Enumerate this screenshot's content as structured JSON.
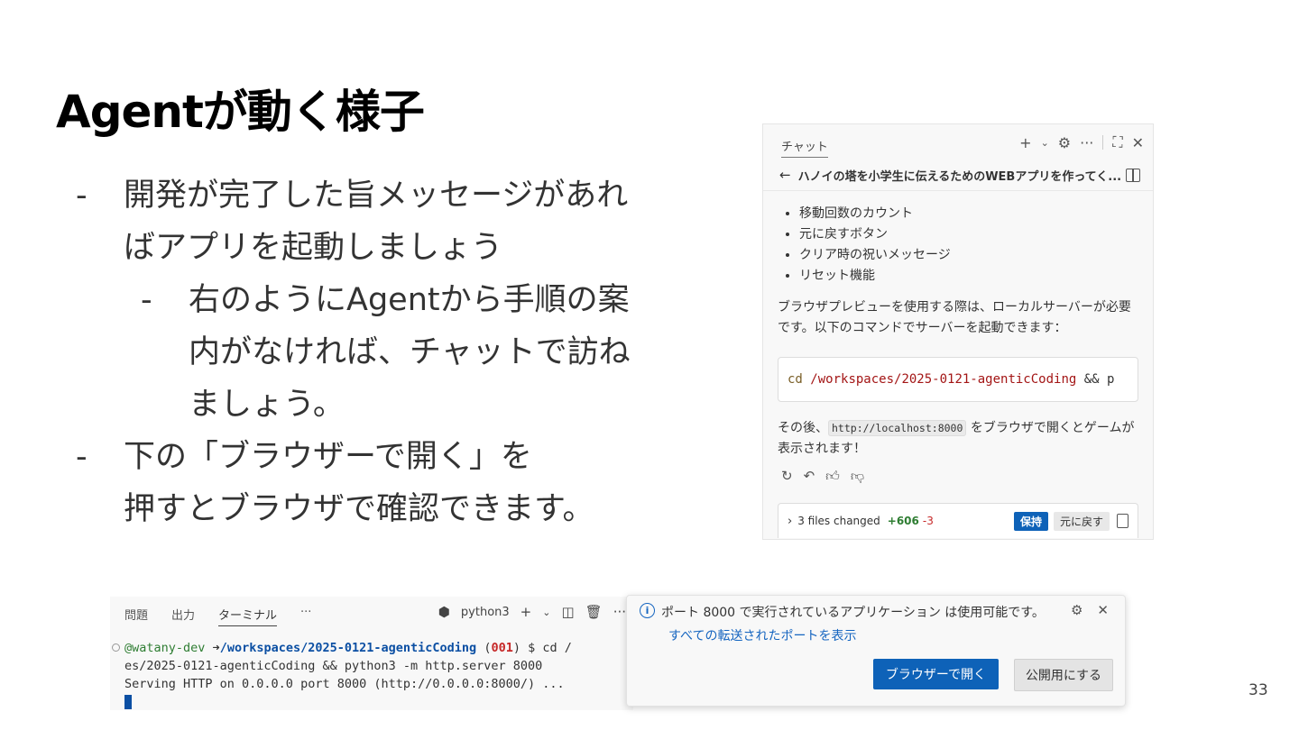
{
  "slide": {
    "title": "Agentが動く様子",
    "page_number": "33",
    "bullets": [
      {
        "lines": [
          "開発が完了した旨メッセージがあれ",
          "ばアプリを起動しましょう"
        ]
      },
      {
        "lines": [
          "右のようにAgentから手順の案",
          "内がなければ、チャットで訪ね",
          "ましょう。"
        ]
      },
      {
        "lines": [
          "下の「ブラウザーで開く」を",
          "押すとブラウザで確認できます。"
        ]
      }
    ]
  },
  "chat": {
    "tab_label": "チャット",
    "header_icons": [
      "plus-icon",
      "chevron-down-icon",
      "gear-icon",
      "more-icon",
      "maximize-icon",
      "close-icon"
    ],
    "title": "ハノイの塔を小学生に伝えるためのWEBアプリを作ってく...",
    "features": [
      "移動回数のカウント",
      "元に戻すボタン",
      "クリア時の祝いメッセージ",
      "リセット機能"
    ],
    "paragraph1": "ブラウザプレビューを使用する際は、ローカルサーバーが必要です。以下のコマンドでサーバーを起動できます：",
    "code": {
      "cmd": "cd",
      "path": "/workspaces/2025-0121-agenticCoding",
      "rest": "&& p"
    },
    "para2_before": "その後、",
    "para2_code": "http://localhost:8000",
    "para2_after": "をブラウザで開くとゲームが表示されます！",
    "files": {
      "label": "3 files changed",
      "added": "+606",
      "removed": "-3",
      "keep": "保持",
      "undo": "元に戻す"
    }
  },
  "terminal": {
    "tabs": [
      "問題",
      "出力",
      "ターミナル",
      "···"
    ],
    "active_tab": "ターミナル",
    "shell": "python3",
    "prompt_user": "@watany-dev",
    "prompt_arrow": "➜",
    "prompt_dir": "/workspaces/2025-0121-agenticCoding",
    "prompt_branch_open": "(",
    "prompt_branch": "001",
    "prompt_branch_close": ")",
    "prompt_cmd": "$ cd /",
    "line2": "es/2025-0121-agenticCoding && python3 -m http.server 8000",
    "line3": "Serving HTTP on 0.0.0.0 port 8000 (http://0.0.0.0:8000/) ..."
  },
  "notification": {
    "message": "ポート 8000 で実行されているアプリケーション は使用可能です。",
    "link": "すべての転送されたポートを表示",
    "primary_button": "ブラウザーで開く",
    "secondary_button": "公開用にする"
  }
}
